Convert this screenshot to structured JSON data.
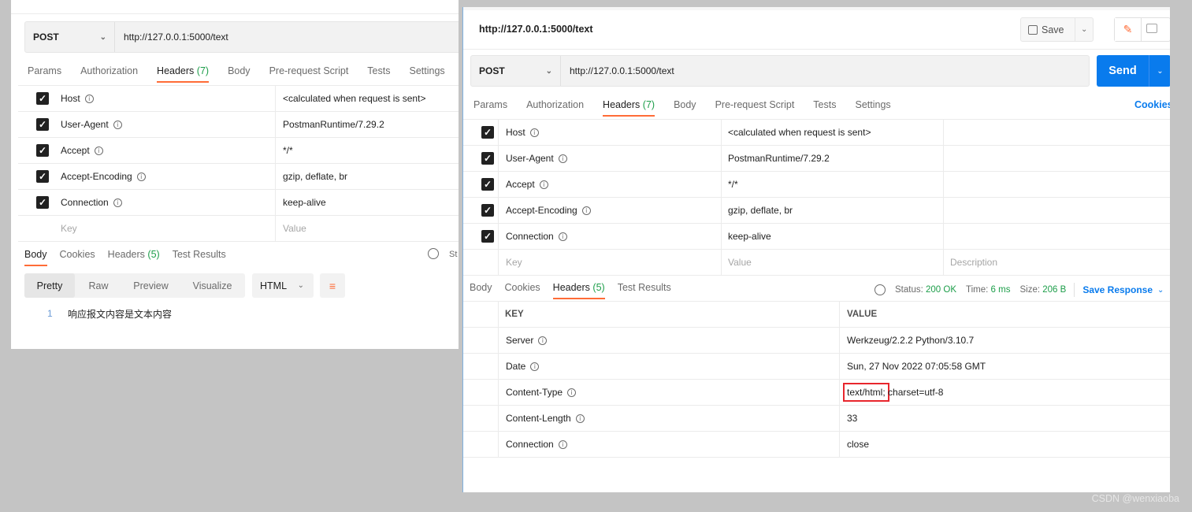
{
  "left": {
    "method": "POST",
    "url": "http://127.0.0.1:5000/text",
    "tabs": [
      {
        "label": "Params"
      },
      {
        "label": "Authorization"
      },
      {
        "label": "Headers",
        "count": "(7)"
      },
      {
        "label": "Body"
      },
      {
        "label": "Pre-request Script"
      },
      {
        "label": "Tests"
      },
      {
        "label": "Settings"
      }
    ],
    "headers": [
      {
        "key": "Host",
        "value": "<calculated when request is sent>"
      },
      {
        "key": "User-Agent",
        "value": "PostmanRuntime/7.29.2"
      },
      {
        "key": "Accept",
        "value": "*/*"
      },
      {
        "key": "Accept-Encoding",
        "value": "gzip, deflate, br"
      },
      {
        "key": "Connection",
        "value": "keep-alive"
      }
    ],
    "key_placeholder": "Key",
    "value_placeholder": "Value",
    "response_tabs": [
      {
        "label": "Body"
      },
      {
        "label": "Cookies"
      },
      {
        "label": "Headers",
        "count": "(5)"
      },
      {
        "label": "Test Results"
      }
    ],
    "status_cut": "St",
    "view_modes": [
      "Pretty",
      "Raw",
      "Preview",
      "Visualize"
    ],
    "format": "HTML",
    "line_number": "1",
    "body_text": "响应报文内容是文本内容"
  },
  "right": {
    "title": "http://127.0.0.1:5000/text",
    "save_label": "Save",
    "method": "POST",
    "url": "http://127.0.0.1:5000/text",
    "send_label": "Send",
    "tabs": [
      {
        "label": "Params"
      },
      {
        "label": "Authorization"
      },
      {
        "label": "Headers",
        "count": "(7)"
      },
      {
        "label": "Body"
      },
      {
        "label": "Pre-request Script"
      },
      {
        "label": "Tests"
      },
      {
        "label": "Settings"
      }
    ],
    "cookies_link": "Cookies",
    "headers": [
      {
        "key": "Host",
        "value": "<calculated when request is sent>"
      },
      {
        "key": "User-Agent",
        "value": "PostmanRuntime/7.29.2"
      },
      {
        "key": "Accept",
        "value": "*/*"
      },
      {
        "key": "Accept-Encoding",
        "value": "gzip, deflate, br"
      },
      {
        "key": "Connection",
        "value": "keep-alive"
      }
    ],
    "key_placeholder": "Key",
    "value_placeholder": "Value",
    "description_placeholder": "Description",
    "response_tabs": [
      {
        "label": "Body"
      },
      {
        "label": "Cookies"
      },
      {
        "label": "Headers",
        "count": "(5)"
      },
      {
        "label": "Test Results"
      }
    ],
    "status_label": "Status:",
    "status_value": "200 OK",
    "time_label": "Time:",
    "time_value": "6 ms",
    "size_label": "Size:",
    "size_value": "206 B",
    "save_response": "Save Response",
    "resp_col_key": "KEY",
    "resp_col_value": "VALUE",
    "response_headers": [
      {
        "key": "Server",
        "value": "Werkzeug/2.2.2 Python/3.10.7"
      },
      {
        "key": "Date",
        "value": "Sun, 27 Nov 2022 07:05:58 GMT"
      },
      {
        "key": "Content-Type",
        "value_highlight": "text/html;",
        "value_rest": " charset=utf-8"
      },
      {
        "key": "Content-Length",
        "value": "33"
      },
      {
        "key": "Connection",
        "value": "close"
      }
    ]
  },
  "watermark": "CSDN @wenxiaoba",
  "colors": {
    "accent": "#ff6c37",
    "send": "#097bed",
    "status_ok": "#1d9e4a",
    "link": "#097bed",
    "highlight_box": "#e8262d"
  }
}
